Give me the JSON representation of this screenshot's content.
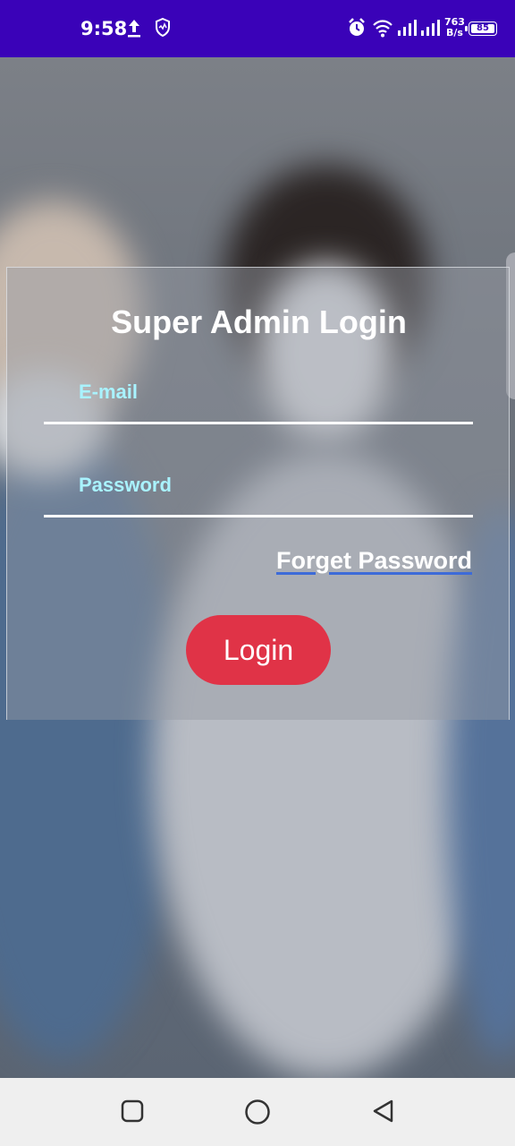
{
  "status_bar": {
    "time": "9:58",
    "net_speed_value": "763",
    "net_speed_unit": "B/s",
    "battery_level": "85",
    "icons": [
      "upload-icon",
      "shield-icon",
      "alarm-icon",
      "wifi-icon",
      "signal-icon",
      "signal-icon"
    ]
  },
  "login": {
    "title": "Super Admin Login",
    "email_label": "E-mail",
    "password_label": "Password",
    "forget_password": "Forget Password",
    "login_button": "Login"
  },
  "colors": {
    "status_bar": "#3a02b8",
    "label": "#a9f3ff",
    "login_button": "#e03347",
    "link_underline": "#3d6bd8",
    "nav_bar": "#efefef"
  },
  "nav_bar": {
    "icons": [
      "recents-icon",
      "home-icon",
      "back-icon"
    ]
  }
}
